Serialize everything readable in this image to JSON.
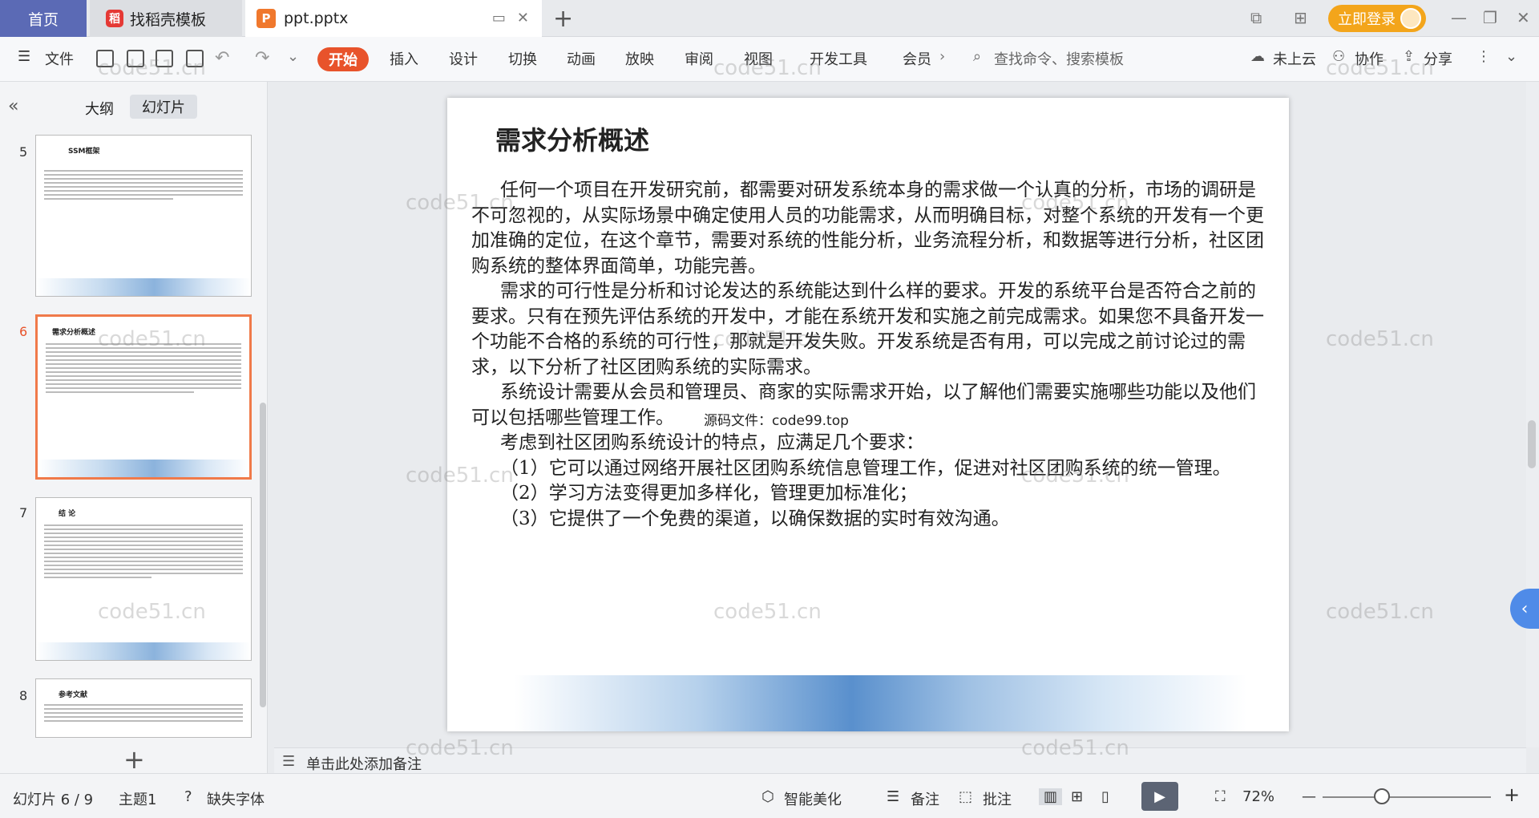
{
  "titlebar": {
    "home_tab": "首页",
    "template_tab": "找稻壳模板",
    "doc_tab": "ppt.pptx",
    "login": "立即登录"
  },
  "toolbar": {
    "file": "文件",
    "menus": [
      "开始",
      "插入",
      "设计",
      "切换",
      "动画",
      "放映",
      "审阅",
      "视图",
      "开发工具",
      "会员"
    ],
    "search_placeholder": "查找命令、搜索模板",
    "cloud": "未上云",
    "collab": "协作",
    "share": "分享"
  },
  "leftpanel": {
    "outline": "大纲",
    "slides": "幻灯片",
    "thumbnails": [
      {
        "num": "5",
        "title": "SSM框架"
      },
      {
        "num": "6",
        "title": "需求分析概述"
      },
      {
        "num": "7",
        "title": "结 论"
      },
      {
        "num": "8",
        "title": "参考文献"
      }
    ]
  },
  "slide": {
    "title": "需求分析概述",
    "paragraphs": [
      "任何一个项目在开发研究前，都需要对研发系统本身的需求做一个认真的分析，市场的调研是不可忽视的，从实际场景中确定使用人员的功能需求，从而明确目标，对整个系统的开发有一个更加准确的定位，在这个章节，需要对系统的性能分析，业务流程分析，和数据等进行分析，社区团购系统的整体界面简单，功能完善。",
      "需求的可行性是分析和讨论发达的系统能达到什么样的要求。开发的系统平台是否符合之前的要求。只有在预先评估系统的开发中，才能在系统开发和实施之前完成需求。如果您不具备开发一个功能不合格的系统的可行性，那就是开发失败。开发系统是否有用，可以完成之前讨论过的需求，以下分析了社区团购系统的实际需求。",
      "系统设计需要从会员和管理员、商家的实际需求开始，以了解他们需要实施哪些功能以及他们可以包括哪些管理工作。",
      "考虑到社区团购系统设计的特点，应满足几个要求：",
      "（1）它可以通过网络开展社区团购系统信息管理工作，促进对社区团购系统的统一管理。",
      "（2）学习方法变得更加多样化，管理更加标准化；",
      "（3）它提供了一个免费的渠道，以确保数据的实时有效沟通。"
    ],
    "overlay_note": "源码文件：code99.top"
  },
  "notes": {
    "placeholder": "单击此处添加备注"
  },
  "statusbar": {
    "slide_pos": "幻灯片 6 / 9",
    "theme": "主题1",
    "missing_font": "缺失字体",
    "beautify": "智能美化",
    "notes": "备注",
    "comments": "批注",
    "zoom": "72%"
  },
  "watermark": "code51.cn",
  "colors": {
    "accent": "#e8532b",
    "home_tab": "#5b6ab5",
    "login": "#f3a51b"
  }
}
